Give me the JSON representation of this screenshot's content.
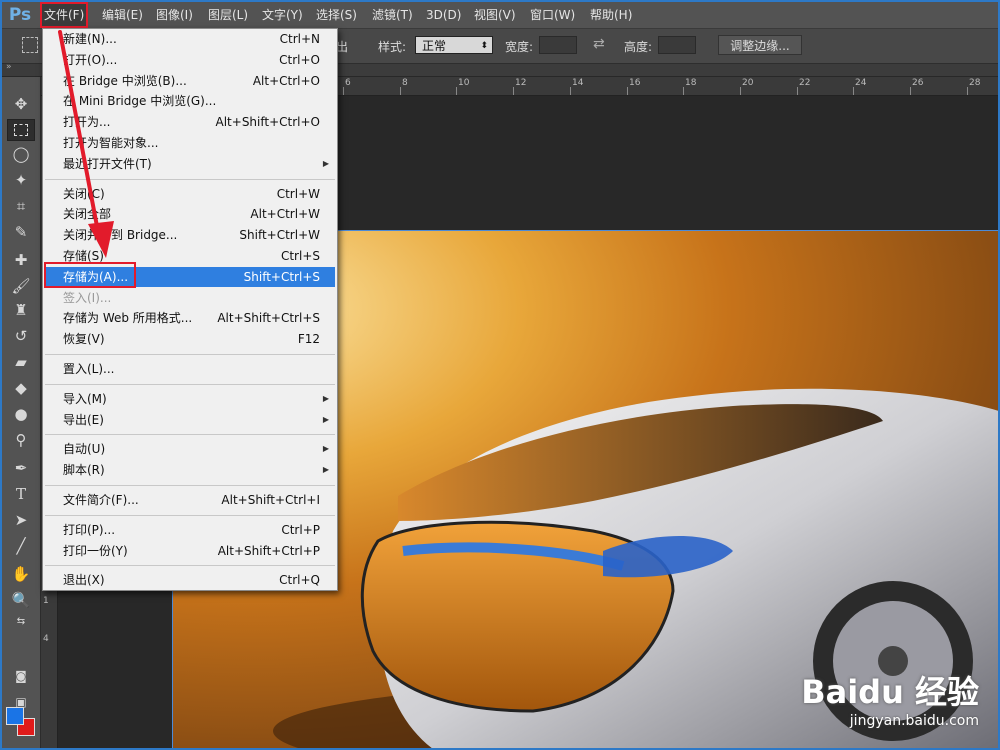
{
  "app": {
    "logo": "Ps"
  },
  "menubar": [
    "文件(F)",
    "编辑(E)",
    "图像(I)",
    "图层(L)",
    "文字(Y)",
    "选择(S)",
    "滤镜(T)",
    "3D(D)",
    "视图(V)",
    "窗口(W)",
    "帮助(H)"
  ],
  "options": {
    "partial_label": "出",
    "style_label": "样式:",
    "style_value": "正常",
    "width_label": "宽度:",
    "height_label": "高度:",
    "refine_button": "调整边缘..."
  },
  "ruler_h": [
    "6",
    "8",
    "10",
    "12",
    "14",
    "16",
    "18",
    "20",
    "22",
    "24",
    "26",
    "28"
  ],
  "ruler_v": [
    "1",
    "4"
  ],
  "file_menu": {
    "groups": [
      [
        {
          "label": "新建(N)...",
          "shortcut": "Ctrl+N"
        },
        {
          "label": "打开(O)...",
          "shortcut": "Ctrl+O"
        },
        {
          "label": "在 Bridge 中浏览(B)...",
          "shortcut": "Alt+Ctrl+O"
        },
        {
          "label": "在 Mini Bridge 中浏览(G)...",
          "shortcut": ""
        },
        {
          "label": "打开为...",
          "shortcut": "Alt+Shift+Ctrl+O"
        },
        {
          "label": "打开为智能对象...",
          "shortcut": ""
        },
        {
          "label": "最近打开文件(T)",
          "shortcut": "",
          "submenu": true
        }
      ],
      [
        {
          "label": "关闭(C)",
          "shortcut": "Ctrl+W"
        },
        {
          "label": "关闭全部",
          "shortcut": "Alt+Ctrl+W"
        },
        {
          "label": "关闭并转到 Bridge...",
          "shortcut": "Shift+Ctrl+W"
        },
        {
          "label": "存储(S)",
          "shortcut": "Ctrl+S"
        },
        {
          "label": "存储为(A)...",
          "shortcut": "Shift+Ctrl+S",
          "highlighted": true
        },
        {
          "label": "签入(I)...",
          "shortcut": "",
          "disabled": true
        },
        {
          "label": "存储为 Web 所用格式...",
          "shortcut": "Alt+Shift+Ctrl+S"
        },
        {
          "label": "恢复(V)",
          "shortcut": "F12"
        }
      ],
      [
        {
          "label": "置入(L)...",
          "shortcut": ""
        }
      ],
      [
        {
          "label": "导入(M)",
          "shortcut": "",
          "submenu": true
        },
        {
          "label": "导出(E)",
          "shortcut": "",
          "submenu": true
        }
      ],
      [
        {
          "label": "自动(U)",
          "shortcut": "",
          "submenu": true
        },
        {
          "label": "脚本(R)",
          "shortcut": "",
          "submenu": true
        }
      ],
      [
        {
          "label": "文件简介(F)...",
          "shortcut": "Alt+Shift+Ctrl+I"
        }
      ],
      [
        {
          "label": "打印(P)...",
          "shortcut": "Ctrl+P"
        },
        {
          "label": "打印一份(Y)",
          "shortcut": "Alt+Shift+Ctrl+P"
        }
      ],
      [
        {
          "label": "退出(X)",
          "shortcut": "Ctrl+Q"
        }
      ]
    ]
  },
  "colors": {
    "foreground": "#1a74e6",
    "background": "#e01b1b",
    "highlight": "#2f7fe0",
    "annotation": "#e21b2b"
  },
  "watermark": {
    "brand": "Baidu 经验",
    "url": "jingyan.baidu.com"
  }
}
